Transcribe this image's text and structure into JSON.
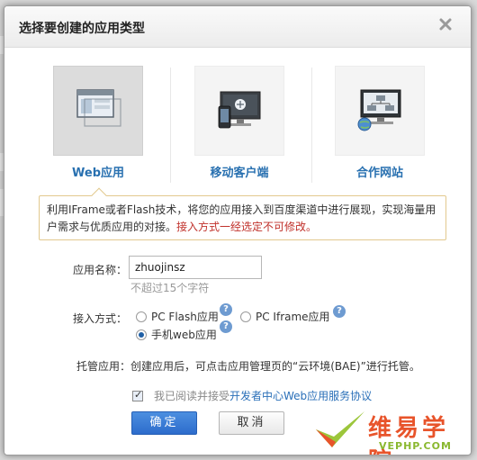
{
  "dialog": {
    "title": "选择要创建的应用类型",
    "close_icon": "close-icon"
  },
  "app_types": [
    {
      "label": "Web应用",
      "icon": "web-window-icon",
      "selected": true
    },
    {
      "label": "移动客户端",
      "icon": "mobile-device-icon",
      "selected": false
    },
    {
      "label": "合作网站",
      "icon": "network-site-icon",
      "selected": false
    }
  ],
  "description": {
    "text": "利用IFrame或者Flash技术，将您的应用接入到百度渠道中进行展现，实现海量用户需求与优质应用的对接。",
    "warning": "接入方式一经选定不可修改。"
  },
  "form": {
    "name_label": "应用名称：",
    "name_value": "zhuojinsz",
    "name_hint": "不超过15个字符",
    "access_label": "接入方式：",
    "access_options": [
      {
        "label": "PC Flash应用",
        "selected": false
      },
      {
        "label": "PC Iframe应用",
        "selected": false
      },
      {
        "label": "手机web应用",
        "selected": true
      }
    ],
    "help_mark": "?",
    "hosted_text": "托管应用：创建应用后，可点击应用管理页的“云环境(BAE)”进行托管。"
  },
  "agreement": {
    "checked": true,
    "prefix": "我已阅读并接受",
    "link": "开发者中心Web应用服务协议"
  },
  "buttons": {
    "ok": "确定",
    "cancel": "取消"
  },
  "watermark": {
    "text": "维易学院",
    "url": "VEPHP.COM"
  },
  "colors": {
    "accent": "#2870b0",
    "warning": "#c0302a",
    "primary_button": "#2d6ccc"
  }
}
